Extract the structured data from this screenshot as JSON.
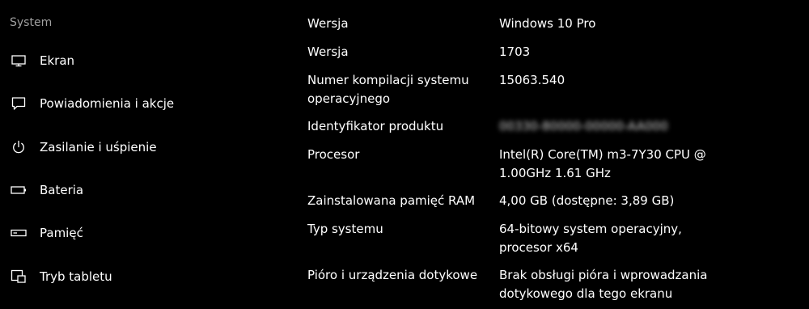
{
  "sidebar": {
    "title": "System",
    "items": [
      {
        "label": "Ekran",
        "icon": "monitor-icon"
      },
      {
        "label": "Powiadomienia i akcje",
        "icon": "notification-icon"
      },
      {
        "label": "Zasilanie i uśpienie",
        "icon": "power-icon"
      },
      {
        "label": "Bateria",
        "icon": "battery-icon"
      },
      {
        "label": "Pamięć",
        "icon": "storage-icon"
      },
      {
        "label": "Tryb tabletu",
        "icon": "tablet-mode-icon"
      }
    ]
  },
  "specs": {
    "edition_label": "Wersja",
    "edition_value": "Windows 10 Pro",
    "version_label": "Wersja",
    "version_value": "1703",
    "build_label_line1": "Numer kompilacji systemu",
    "build_label_line2": "operacyjnego",
    "build_value": "15063.540",
    "product_id_label": "Identyfikator produktu",
    "product_id_value": "00330-80000-00000-AA000",
    "processor_label": "Procesor",
    "processor_value_line1": "Intel(R) Core(TM) m3-7Y30 CPU @",
    "processor_value_line2": "1.00GHz   1.61 GHz",
    "ram_label": "Zainstalowana pamięć RAM",
    "ram_value": "4,00 GB (dostępne: 3,89 GB)",
    "system_type_label": "Typ systemu",
    "system_type_value_line1": "64-bitowy system operacyjny,",
    "system_type_value_line2": "procesor x64",
    "pen_touch_label": "Pióro i urządzenia dotykowe",
    "pen_touch_value_line1": "Brak obsługi pióra i wprowadzania",
    "pen_touch_value_line2": "dotykowego dla tego ekranu"
  }
}
